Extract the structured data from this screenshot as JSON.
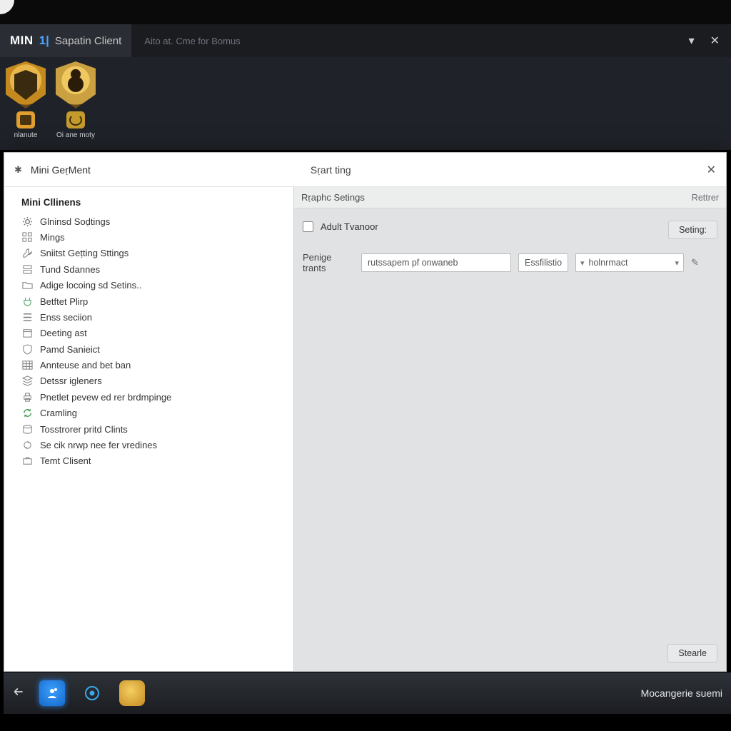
{
  "header": {
    "logo_text": "MIN",
    "logo_colon": "1|",
    "title": "Sapatin Client",
    "subtitle": "Aito at. Cme for Bomus"
  },
  "launcher": {
    "badge1_label": "nlanute",
    "badge2_label": "Oi ane moty"
  },
  "dialog": {
    "title_left": "Mini GeṛMent",
    "title_right": "Sṛart ting",
    "section_header": "Rṛaphc Setings",
    "section_right": "Rettrer",
    "checkbox_label": "Adult Tvanoor",
    "settings_btn": "Seting:",
    "form_label": "Penige trants",
    "form_input_value": "rutssapem pf onwaneb",
    "form_small_value": "Essfilistione",
    "form_select_value": "holnrmact",
    "start_btn": "Stearle"
  },
  "sidebar": {
    "heading": "Mini Cllinens",
    "items": [
      {
        "label": "Glninsd Soḍtings"
      },
      {
        "label": "Mings"
      },
      {
        "label": "Sniitst Geṭting Sttings"
      },
      {
        "label": "Tund Sdannes"
      },
      {
        "label": "Adige locoing sd Setins.."
      },
      {
        "label": "Betftet Plirp"
      },
      {
        "label": "Enss seciion"
      },
      {
        "label": "Deeting ast"
      },
      {
        "label": "Pamd Sanieict"
      },
      {
        "label": "Annteuse and bet ban"
      },
      {
        "label": "Detssr igleners"
      },
      {
        "label": "Pnetlet pevew ed rer brdmpinge"
      },
      {
        "label": "Cramling"
      },
      {
        "label": "Tosstrorer pritd Clints"
      },
      {
        "label": "Se cik nrwp nee fer vredines"
      },
      {
        "label": "Temt Clisent"
      }
    ]
  },
  "taskbar": {
    "status_text": "Mocangerie suemi"
  }
}
